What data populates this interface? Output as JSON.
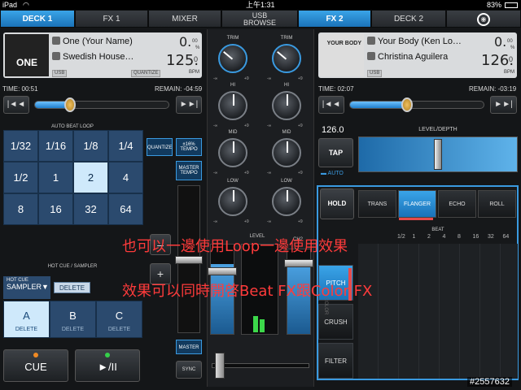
{
  "status": {
    "device": "iPad",
    "time": "上午1:31",
    "battery": "83%"
  },
  "tabs": {
    "deck1": "DECK 1",
    "fx1": "FX 1",
    "mixer": "MIXER",
    "usb1": "USB",
    "usb2": "BROWSE",
    "fx2": "FX 2",
    "deck2": "DECK 2"
  },
  "deck1": {
    "title": "One (Your Name)",
    "artist": "Swedish House…",
    "key_value": "0.",
    "key_unit": "00",
    "key_sym": "%",
    "bpm": "125.",
    "bpm_dec": "0",
    "bpm_unit": "BPM",
    "usb": "USB",
    "quantize": "QUANTIZE",
    "art_text": "ONE",
    "time": "TIME: 00:51",
    "remain": "REMAIN: -04:59",
    "seek": 0.26
  },
  "deck2": {
    "title": "Your Body (Ken Lo…",
    "artist": "Christina Aguilera",
    "key_value": "0.",
    "key_unit": "00",
    "key_sym": "%",
    "bpm": "126.",
    "bpm_dec": "0",
    "bpm_unit": "BPM",
    "usb": "USB",
    "art_text": "YOUR BODY",
    "time": "TIME: 02:07",
    "remain": "REMAIN: -03:19",
    "seek": 0.42
  },
  "loop": {
    "title": "AUTO BEAT LOOP",
    "cells": [
      "1/32",
      "1/16",
      "1/8",
      "1/4",
      "1/2",
      "1",
      "2",
      "4",
      "8",
      "16",
      "32",
      "64"
    ],
    "active": "2"
  },
  "side": {
    "quantize": "QUANTIZE",
    "tempo_pct1": "±16%",
    "tempo_pct2": "TEMPO",
    "master_tempo1": "MASTER",
    "master_tempo2": "TEMPO",
    "master": "MASTER",
    "sync": "SYNC",
    "plus": "+"
  },
  "hotcue": {
    "title": "HOT CUE / SAMPLER",
    "mode1": "HOT CUE",
    "mode2": "SAMPLER▼",
    "delete": "DELETE",
    "pads": [
      {
        "label": "A",
        "sub": "DELETE"
      },
      {
        "label": "B",
        "sub": "DELETE"
      },
      {
        "label": "C",
        "sub": "DELETE"
      }
    ]
  },
  "transport": {
    "cue": "CUE",
    "play": "►/II"
  },
  "mixer": {
    "trim": "TRIM",
    "hi": "HI",
    "mid": "MID",
    "low": "LOW",
    "level": "LEVEL",
    "ch2": "CH2",
    "min": "-∞",
    "max": "+9"
  },
  "fx2": {
    "bpm": "126.0",
    "level_depth": "LEVEL/DEPTH",
    "tap": "TAP",
    "auto": "▬ AUTO",
    "hold": "HOLD",
    "effects": [
      "TRANS",
      "FLANGER",
      "ECHO",
      "ROLL"
    ],
    "active": "FLANGER",
    "beat_title": "BEAT",
    "beats": [
      "1/2",
      "1",
      "2",
      "4",
      "8",
      "16",
      "32",
      "64"
    ],
    "side": [
      "PITCH",
      "CRUSH",
      "FILTER"
    ],
    "color": "COLOR"
  },
  "overlay": {
    "line1": "也可以一邊使用Loop一邊使用效果",
    "line2": "效果可以同時開啓Beat FX跟Color FX",
    "watermark": "#2557632"
  }
}
